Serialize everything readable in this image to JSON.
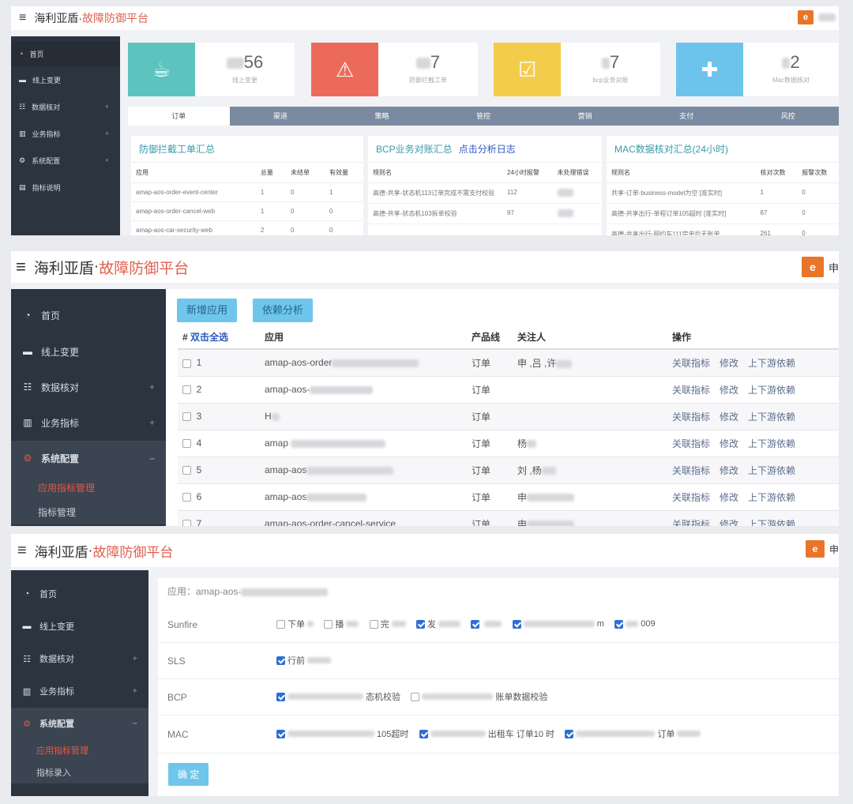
{
  "app": {
    "brand": "海利亚盾",
    "dot": "·",
    "accent": "故障防御平台",
    "menu_glyph": "≡",
    "logo_short": "申"
  },
  "sidebar": {
    "items": [
      {
        "label": "首页",
        "icon": "dashboard-icon",
        "glyph": "◔"
      },
      {
        "label": "线上变更",
        "icon": "coffee-icon",
        "glyph": "▬"
      },
      {
        "label": "数据核对",
        "icon": "grid-icon",
        "glyph": "☷",
        "plus": "+"
      },
      {
        "label": "业务指标",
        "icon": "bar-chart-icon",
        "glyph": "▥",
        "plus": "+"
      },
      {
        "label": "系统配置",
        "icon": "cogs-icon",
        "glyph": "⚙",
        "plus": "+",
        "minus": "–"
      },
      {
        "label": "指标说明",
        "icon": "doc-icon",
        "glyph": "▤"
      }
    ],
    "sub_p2": [
      "应用指标管理",
      "指标管理"
    ],
    "sub_p3": [
      "应用指标管理",
      "指标录入"
    ]
  },
  "dashboard": {
    "stats": [
      {
        "num": "56",
        "label": "线上变更",
        "color": "#5ec3be",
        "icon": "cup-icon",
        "glyph": "☕"
      },
      {
        "num": "7",
        "label": "防御拦截工单",
        "color": "#ec6a59",
        "icon": "warning-icon",
        "glyph": "⚠"
      },
      {
        "num": "7",
        "label": "bcp业务对账",
        "color": "#f4cc4c",
        "icon": "checkbox-icon",
        "glyph": "☑"
      },
      {
        "num": "2",
        "label": "Mac数据核对",
        "color": "#6cc3ec",
        "icon": "plus-box-icon",
        "glyph": "✚"
      }
    ],
    "tabs": [
      "订单",
      "渠道",
      "策略",
      "管控",
      "营销",
      "支付",
      "风控"
    ],
    "card1": {
      "title": "防御拦截工单汇总",
      "headers": [
        "应用",
        "总量",
        "未结单",
        "有效量"
      ],
      "rows": [
        [
          "amap-aos-order-event-center",
          "1",
          "0",
          "1"
        ],
        [
          "amap-aos-order-cancel-web",
          "1",
          "0",
          "0"
        ],
        [
          "amap-aos-car-security-web",
          "2",
          "0",
          "0"
        ]
      ]
    },
    "card2": {
      "title": "BCP业务对账汇总",
      "link": "点击分析日志",
      "headers": [
        "规则名",
        "24小时报警",
        "未处理错误"
      ],
      "rows": [
        [
          "高德-共享-状态机113订单完成不需支付校验",
          "112"
        ],
        [
          "高德-共享-状态机103拆单校验",
          "97"
        ]
      ]
    },
    "card3": {
      "title": "MAC数据核对汇总(24小时)",
      "headers": [
        "规则名",
        "核对次数",
        "报警次数"
      ],
      "rows": [
        [
          "共享-订单-business-model为空 [准实时]",
          "1",
          "0"
        ],
        [
          "高德-共享出行-单程订单105超时 [准实时]",
          "87",
          "0"
        ],
        [
          "高德-共享出行-网约车111完单后无账单",
          "261",
          "0"
        ]
      ]
    }
  },
  "app_list": {
    "buttons": [
      "新增应用",
      "依赖分析"
    ],
    "headers": {
      "hash": "#",
      "select_all": "双击全选",
      "app": "应用",
      "product": "产品线",
      "follower": "关注人",
      "ops": "操作"
    },
    "rows": [
      {
        "n": "1",
        "app": "amap-aos-order",
        "product": "订单",
        "follower": "申 ,吕 ,许"
      },
      {
        "n": "2",
        "app": "amap-aos-",
        "product": "订单",
        "follower": ""
      },
      {
        "n": "3",
        "app": "H",
        "product": "订单",
        "follower": ""
      },
      {
        "n": "4",
        "app": "amap",
        "product": "订单",
        "follower": "杨"
      },
      {
        "n": "5",
        "app": "amap-aos",
        "product": "订单",
        "follower": "刘 ,杨"
      },
      {
        "n": "6",
        "app": "amap-aos",
        "product": "订单",
        "follower": "申"
      },
      {
        "n": "7",
        "app": "amap-aos-order-cancel-service",
        "product": "订单",
        "follower": "申"
      }
    ],
    "actions": [
      "关联指标",
      "修改",
      "上下游依赖"
    ]
  },
  "config_form": {
    "app_label": "应用：amap-aos-",
    "rows": [
      {
        "label": "Sunfire",
        "options": [
          {
            "text": "下单",
            "checked": false
          },
          {
            "text": "播",
            "checked": false
          },
          {
            "text": "完",
            "checked": false
          },
          {
            "text": "发",
            "checked": true
          },
          {
            "text": "",
            "checked": true
          },
          {
            "text": "m",
            "checked": true
          },
          {
            "text": "009",
            "checked": true
          }
        ]
      },
      {
        "label": "SLS",
        "options": [
          {
            "text": "行前",
            "checked": true
          }
        ]
      },
      {
        "label": "BCP",
        "options": [
          {
            "text": "态机校验",
            "checked": true
          },
          {
            "text": "账单数据校验",
            "checked": false
          }
        ]
      },
      {
        "label": "MAC",
        "options": [
          {
            "text": "105超时",
            "checked": true
          },
          {
            "text": "出租车 订单10 时",
            "checked": true
          },
          {
            "text": "订单",
            "checked": true
          }
        ]
      }
    ],
    "confirm": "确 定"
  }
}
